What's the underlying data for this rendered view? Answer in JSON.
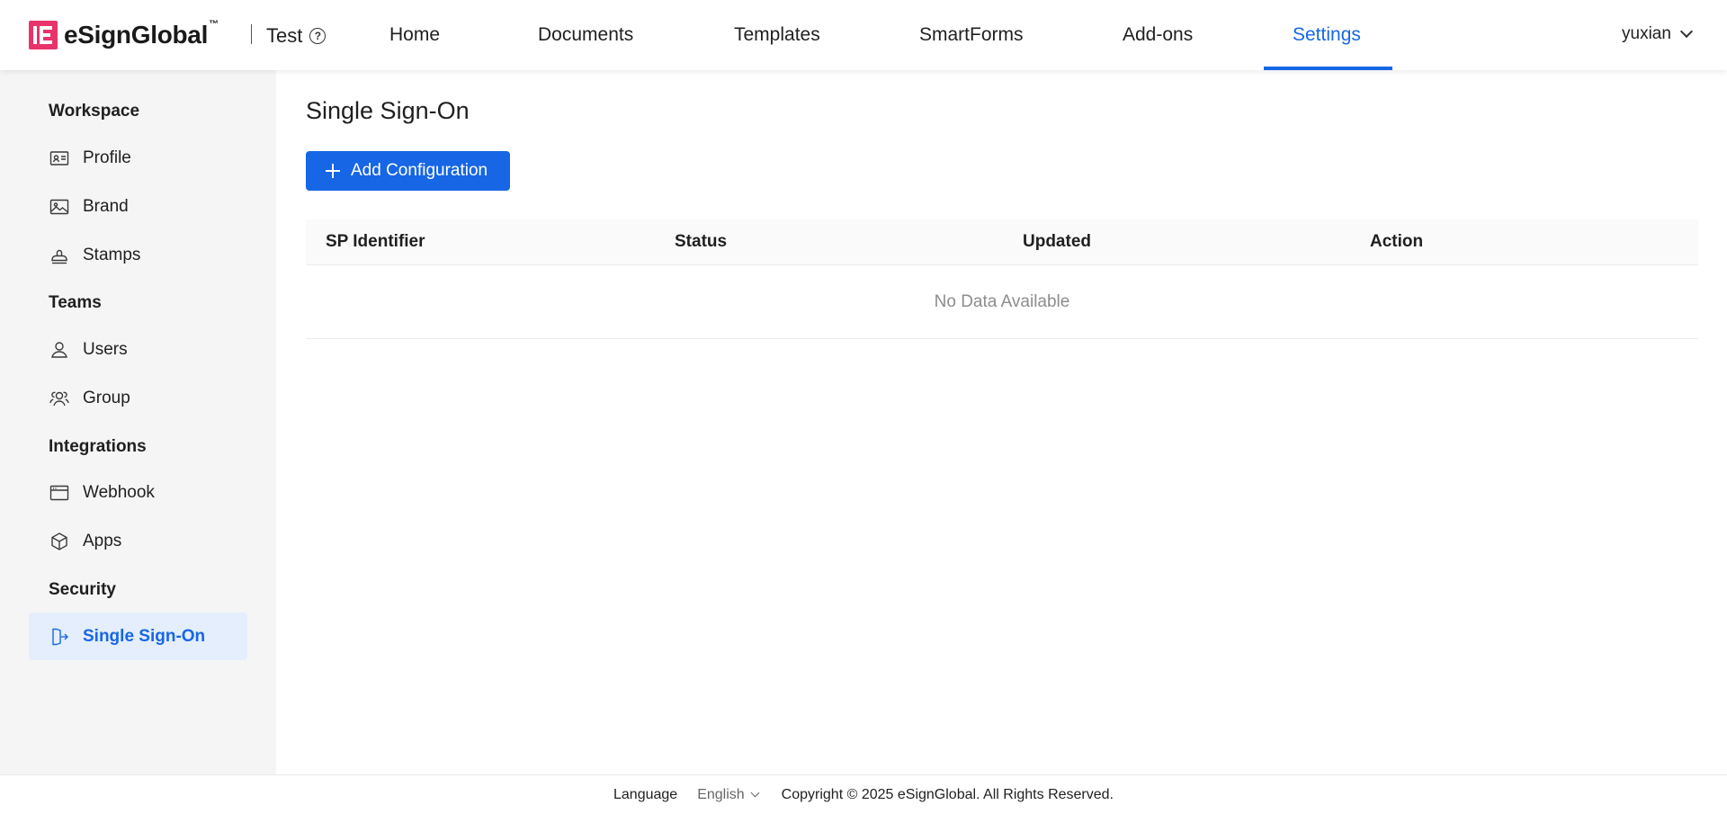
{
  "header": {
    "brand": "eSignGlobal",
    "brand_tm": "™",
    "workspace": "Test",
    "help_glyph": "?",
    "nav": [
      {
        "label": "Home",
        "active": false
      },
      {
        "label": "Documents",
        "active": false
      },
      {
        "label": "Templates",
        "active": false
      },
      {
        "label": "SmartForms",
        "active": false
      },
      {
        "label": "Add-ons",
        "active": false
      },
      {
        "label": "Settings",
        "active": true
      }
    ],
    "user": "yuxian",
    "accent_color": "#1766e6",
    "brand_color": "#e8336b"
  },
  "sidebar": {
    "sections": [
      {
        "title": "Workspace",
        "items": [
          {
            "label": "Profile",
            "icon": "id-card-icon"
          },
          {
            "label": "Brand",
            "icon": "image-icon"
          },
          {
            "label": "Stamps",
            "icon": "stamp-icon"
          }
        ]
      },
      {
        "title": "Teams",
        "items": [
          {
            "label": "Users",
            "icon": "user-icon"
          },
          {
            "label": "Group",
            "icon": "group-icon"
          }
        ]
      },
      {
        "title": "Integrations",
        "items": [
          {
            "label": "Webhook",
            "icon": "browser-window-icon"
          },
          {
            "label": "Apps",
            "icon": "cube-icon"
          }
        ]
      },
      {
        "title": "Security",
        "items": [
          {
            "label": "Single Sign-On",
            "icon": "sign-in-icon",
            "active": true
          }
        ]
      }
    ]
  },
  "main": {
    "title": "Single Sign-On",
    "add_button": "Add Configuration",
    "table": {
      "columns": [
        "SP Identifier",
        "Status",
        "Updated",
        "Action"
      ],
      "empty_text": "No Data Available"
    }
  },
  "footer": {
    "language_label": "Language",
    "language_value": "English",
    "copyright": "Copyright © 2025 eSignGlobal. All Rights Reserved."
  }
}
